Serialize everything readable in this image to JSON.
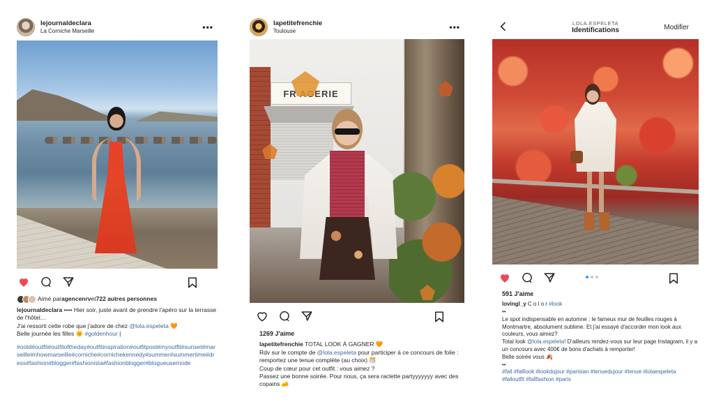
{
  "posts": [
    {
      "username": "lejournaldeclara",
      "location": "La Corniche Marseille",
      "more": "•••",
      "liked_by_prefix": "Aimé par ",
      "liked_by_user": "agencenrv",
      "liked_by_and": " et ",
      "liked_by_others": "722 autres personnes",
      "caption_user": "lejournaldeclara",
      "caption_lines": [
        " •••• Hier soir, juste avant de prendre l'apéro sur la terrasse de l'hôtel…",
        "J'ai ressorti cette robe que j'adore de chez ",
        "Belle journée les filles "
      ],
      "caption_mention": "@lola.espeleta",
      "caption_emoji_1": "🧡",
      "caption_hashtag": "#goldenhour",
      "caption_sun": "🌞",
      "caption_bar": " |",
      "hashtags": "#ootd#outfit#outfitoftheday#outfitinspiration#outfitpost#myoutfit#sunset#marseille#nhowmarseille#corniche#cornichekennedy#summer#summertime#dress#fashion#blogger#fashionista#fashionblogger#blogueusemode",
      "liked": true
    },
    {
      "username": "lapetitefrenchie",
      "location": "Toulouse",
      "more": "•••",
      "shop_sign": "FR   AGERIE",
      "likes": "1269 J'aime",
      "caption_user": "lapetitefrenchie",
      "caption_first": " TOTAL LOOK À GAGNER ",
      "caption_first_emoji": "🧡",
      "caption_rdv_a": "Rdv sur le compte de ",
      "caption_mention": "@lola.espeleta",
      "caption_rdv_b": " pour participer à ce concours de folie : remportez une tenue complète (au choix) ",
      "caption_rdv_emoji": "🎊",
      "caption_q": "Coup de cœur pour cet outfit : vous aimez ?",
      "caption_last": "Passez une bonne soirée. Pour nous, ça sera raclette partyyyyyyy avec des copains ",
      "caption_last_emoji": "🧀",
      "liked": false
    },
    {
      "nav_sub": "LOLA.ESPELETA",
      "nav_title": "Identifications",
      "nav_edit": "Modifier",
      "likes": "591 J'aime",
      "caption_user": "lovingl_y",
      "caption_user_tail": " C o l o r ",
      "caption_user_tag": "#look",
      "sep": "••",
      "caption_para1": "Le spot indispensable en automne : le fameux mur de feuilles rouges à Montmartre, absolument sublime. Et j'ai essayé d'accorder mon look aux couleurs, vous aimez?",
      "caption_para2_a": "Total look ",
      "caption_mention": "@lola.espeleta",
      "caption_para2_b": "! D'ailleurs rendez-vous sur leur page Instagram, il y a un concours avec 400€ de bons d'achats à remporter!",
      "caption_para3": "Belle soirée vous ",
      "caption_para3_emoji": "🍂",
      "sep2": "••",
      "hashtags": "#fall #falllook #lookdujour #parisian #tenuedujour #tenue #lolaespeleta #falloutfit #fallfashion #paris",
      "liked": true
    }
  ],
  "icons": {
    "like": "heart-icon",
    "comment": "comment-icon",
    "share": "share-icon",
    "save": "bookmark-icon",
    "more": "more-icon",
    "back": "back-arrow-icon"
  },
  "colors": {
    "like_red": "#ed4956",
    "link_blue": "#3d6a9e",
    "carousel_active": "#3897f0"
  }
}
